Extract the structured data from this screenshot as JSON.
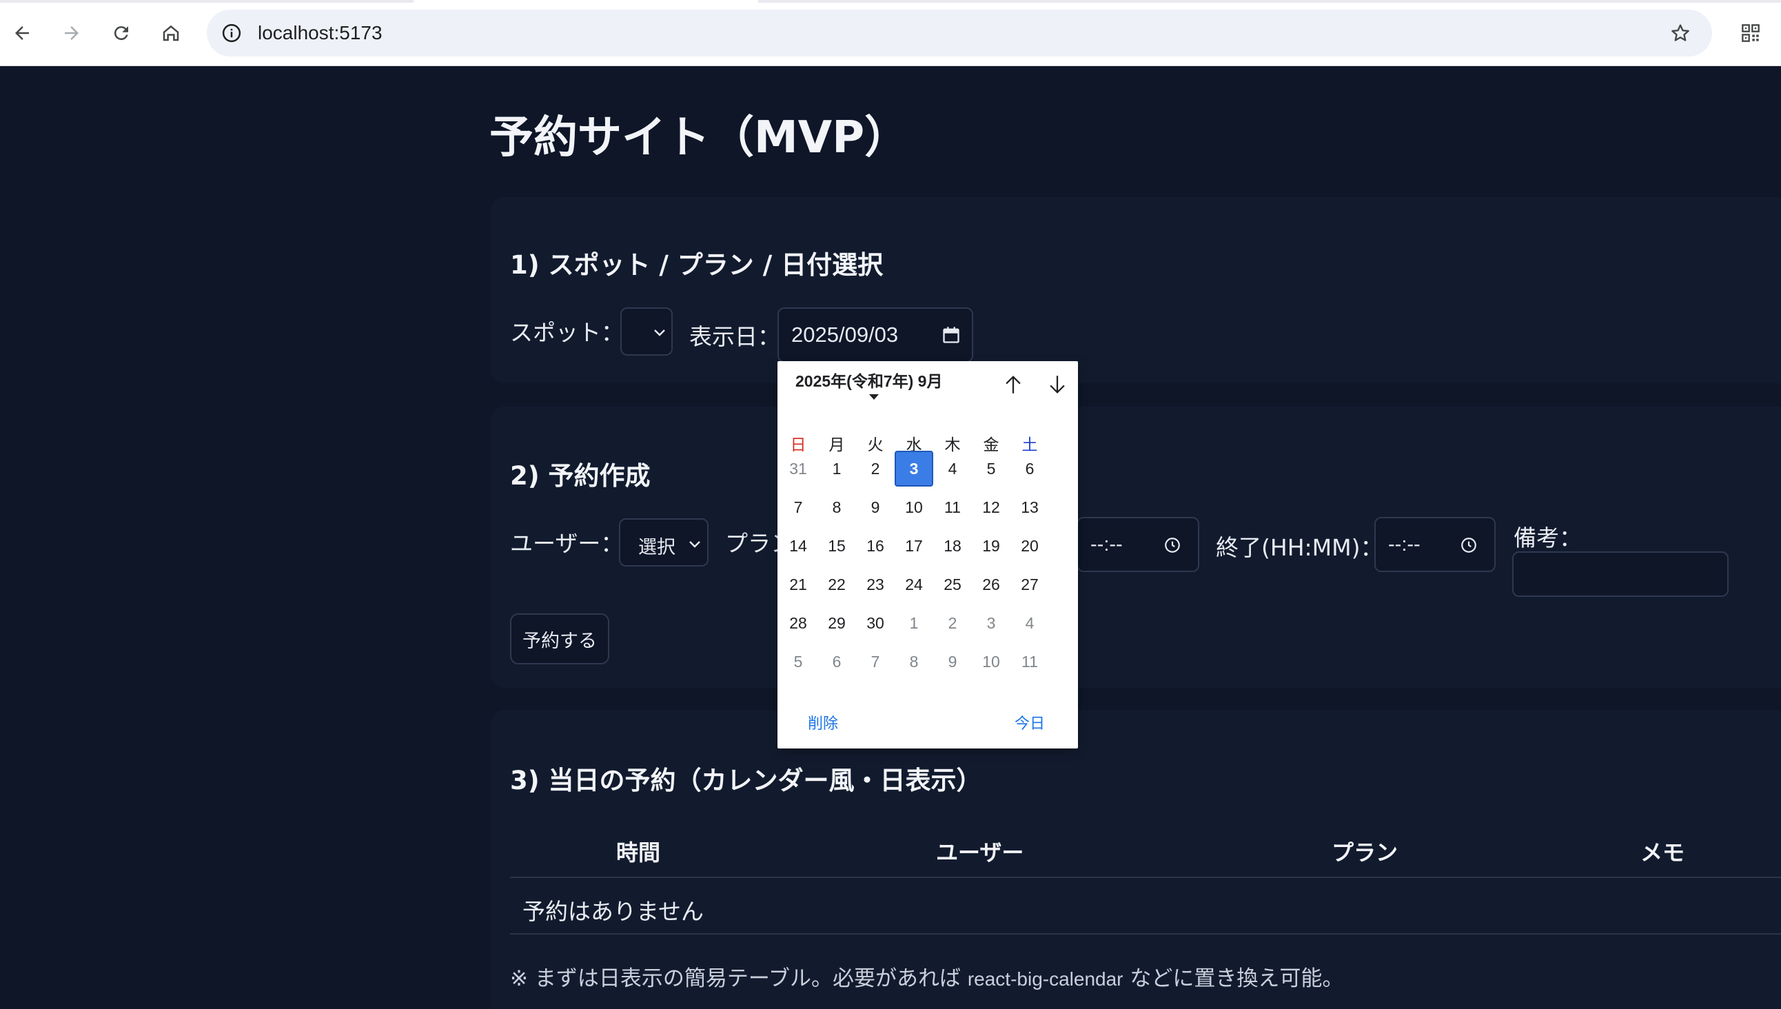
{
  "browser": {
    "url": "localhost:5173"
  },
  "page": {
    "title": "予約サイト（MVP）"
  },
  "section1": {
    "title": "1) スポット / プラン / 日付選択",
    "spot_label": "スポット：",
    "spot_value": "",
    "date_label": "表示日：",
    "date_value": "2025/09/03"
  },
  "section2": {
    "title": "2) 予約作成",
    "user_label": "ユーザー：",
    "user_value": "選択",
    "plan_label": "プラン",
    "start_value": "--:--",
    "end_label": "終了(HH:MM)：",
    "end_value": "--:--",
    "memo_label": "備考：",
    "memo_value": "",
    "submit_label": "予約する"
  },
  "section3": {
    "title": "3) 当日の予約（カレンダー風・日表示）",
    "columns": [
      "時間",
      "ユーザー",
      "プラン",
      "メモ"
    ],
    "empty_message": "予約はありません",
    "note_prefix": "※ まずは日表示の簡易テーブル。必要があれば ",
    "note_lib": "react-big-calendar",
    "note_suffix": " などに置き換え可能。"
  },
  "datepicker": {
    "month_label": "2025年(令和7年) 9月",
    "weekdays": [
      "日",
      "月",
      "火",
      "水",
      "木",
      "金",
      "土"
    ],
    "weeks": [
      [
        "31",
        "1",
        "2",
        "3",
        "4",
        "5",
        "6"
      ],
      [
        "7",
        "8",
        "9",
        "10",
        "11",
        "12",
        "13"
      ],
      [
        "14",
        "15",
        "16",
        "17",
        "18",
        "19",
        "20"
      ],
      [
        "21",
        "22",
        "23",
        "24",
        "25",
        "26",
        "27"
      ],
      [
        "28",
        "29",
        "30",
        "1",
        "2",
        "3",
        "4"
      ],
      [
        "5",
        "6",
        "7",
        "8",
        "9",
        "10",
        "11"
      ]
    ],
    "selected_day": "3",
    "clear_label": "削除",
    "today_label": "今日"
  },
  "colors": {
    "background": "#0e1628",
    "card": "#121b2e",
    "selected_day": "#3b7de6",
    "link": "#1a73e8",
    "sunday": "#d93025",
    "saturday": "#1a3fd0"
  },
  "icons": [
    "back-arrow-icon",
    "forward-arrow-icon",
    "reload-icon",
    "home-icon",
    "info-icon",
    "star-icon",
    "qr-code-icon",
    "calendar-icon",
    "clock-icon",
    "chevron-down-icon",
    "arrow-up-icon",
    "arrow-down-icon"
  ]
}
